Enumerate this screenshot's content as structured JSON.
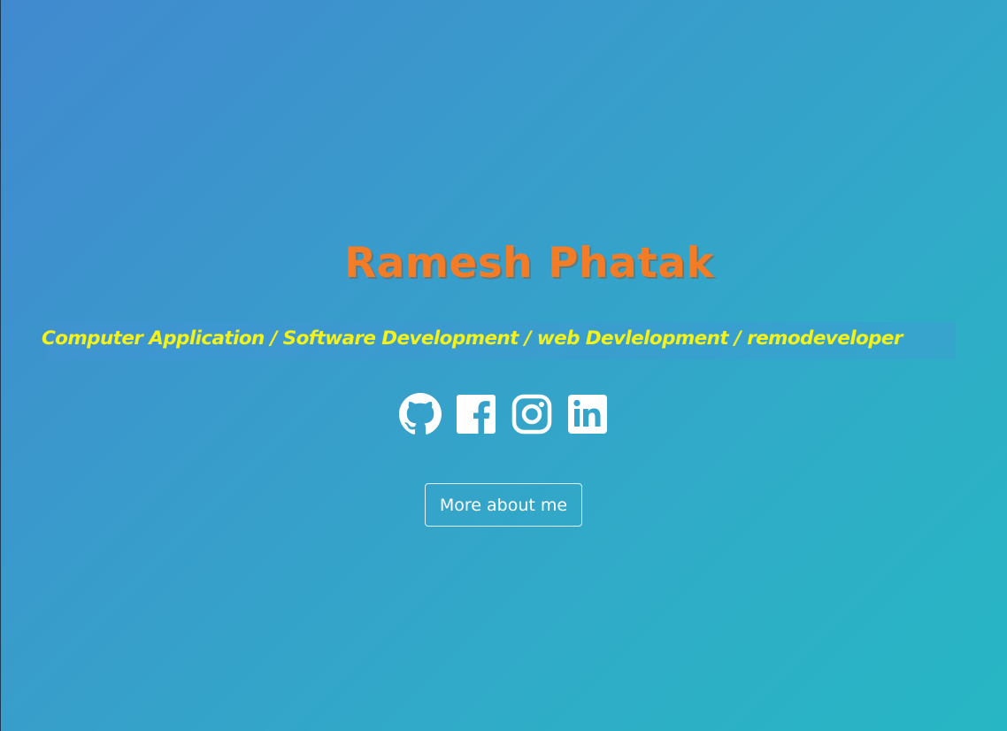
{
  "hero": {
    "name": "Ramesh Phatak",
    "tagline": "Computer Application / Software Development / web Devlelopment / remodeveloper",
    "cta_label": "More about me"
  },
  "social_links": [
    {
      "name": "github",
      "icon": "github-icon"
    },
    {
      "name": "facebook",
      "icon": "facebook-icon"
    },
    {
      "name": "instagram",
      "icon": "instagram-icon"
    },
    {
      "name": "linkedin",
      "icon": "linkedin-icon"
    }
  ],
  "colors": {
    "name": "#f57c26",
    "tagline": "#f4f21a",
    "background_start": "#4189cf",
    "background_end": "#27b6c4",
    "icons": "#ffffff"
  }
}
